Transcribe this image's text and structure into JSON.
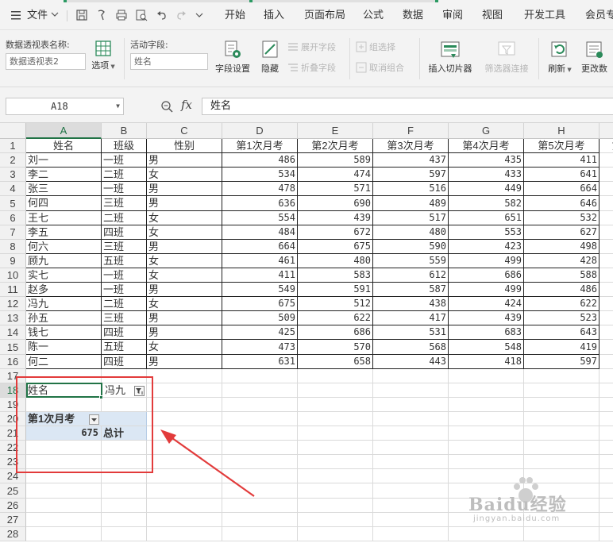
{
  "menubar": {
    "file_label": "文件",
    "tabs": [
      "开始",
      "插入",
      "页面布局",
      "公式",
      "数据",
      "审阅",
      "视图",
      "开发工具",
      "会员专"
    ]
  },
  "ribbon": {
    "pivot_name_label": "数据透视表名称:",
    "pivot_name_value": "数据透视表2",
    "options_label": "选项",
    "active_field_label": "活动字段:",
    "active_field_value": "姓名",
    "field_settings": "字段设置",
    "hide": "隐藏",
    "expand_field": "展开字段",
    "collapse_field": "折叠字段",
    "group_selection": "组选择",
    "ungroup": "取消组合",
    "insert_slicer": "插入切片器",
    "filter_connections": "筛选器连接",
    "refresh": "刷新",
    "change_source": "更改数"
  },
  "formula_bar": {
    "cell_ref": "A18",
    "fx_label": "fx",
    "content": "姓名"
  },
  "columns": [
    "A",
    "B",
    "C",
    "D",
    "E",
    "F",
    "G",
    "H",
    "I"
  ],
  "rows": [
    "1",
    "2",
    "3",
    "4",
    "5",
    "6",
    "7",
    "8",
    "9",
    "10",
    "11",
    "12",
    "13",
    "14",
    "15",
    "16",
    "17",
    "18",
    "19",
    "20",
    "21",
    "22",
    "23",
    "24",
    "25",
    "26",
    "27",
    "28"
  ],
  "table": {
    "headers": [
      "姓名",
      "班级",
      "性别",
      "第1次月考",
      "第2次月考",
      "第3次月考",
      "第4次月考",
      "第5次月考",
      "第"
    ],
    "records": [
      [
        "刘一",
        "一班",
        "男",
        "486",
        "589",
        "437",
        "435",
        "411"
      ],
      [
        "李二",
        "二班",
        "女",
        "534",
        "474",
        "597",
        "433",
        "641"
      ],
      [
        "张三",
        "一班",
        "男",
        "478",
        "571",
        "516",
        "449",
        "664"
      ],
      [
        "何四",
        "三班",
        "男",
        "636",
        "690",
        "489",
        "582",
        "646"
      ],
      [
        "王七",
        "二班",
        "女",
        "554",
        "439",
        "517",
        "651",
        "532"
      ],
      [
        "李五",
        "四班",
        "女",
        "484",
        "672",
        "480",
        "553",
        "627"
      ],
      [
        "何六",
        "三班",
        "男",
        "664",
        "675",
        "590",
        "423",
        "498"
      ],
      [
        "顾九",
        "五班",
        "女",
        "461",
        "480",
        "559",
        "499",
        "428"
      ],
      [
        "实七",
        "一班",
        "女",
        "411",
        "583",
        "612",
        "686",
        "588"
      ],
      [
        "赵多",
        "一班",
        "男",
        "549",
        "591",
        "587",
        "499",
        "486"
      ],
      [
        "冯九",
        "二班",
        "女",
        "675",
        "512",
        "438",
        "424",
        "622"
      ],
      [
        "孙五",
        "三班",
        "男",
        "509",
        "622",
        "417",
        "439",
        "523"
      ],
      [
        "钱七",
        "四班",
        "男",
        "425",
        "686",
        "531",
        "683",
        "643"
      ],
      [
        "陈一",
        "五班",
        "女",
        "473",
        "570",
        "568",
        "548",
        "419"
      ],
      [
        "何二",
        "四班",
        "男",
        "631",
        "658",
        "443",
        "418",
        "597"
      ]
    ]
  },
  "pivot": {
    "filter_field": "姓名",
    "filter_value": "冯九",
    "value_field": "第1次月考",
    "value": "675",
    "total_label": "总计"
  },
  "colors": {
    "accent_green": "#217346",
    "annotation_red": "#e23b3b",
    "pivot_header_bg": "#dbe7f4"
  },
  "watermark": {
    "text": "Baidu经验",
    "sub": "jingyan.baidu.com"
  }
}
